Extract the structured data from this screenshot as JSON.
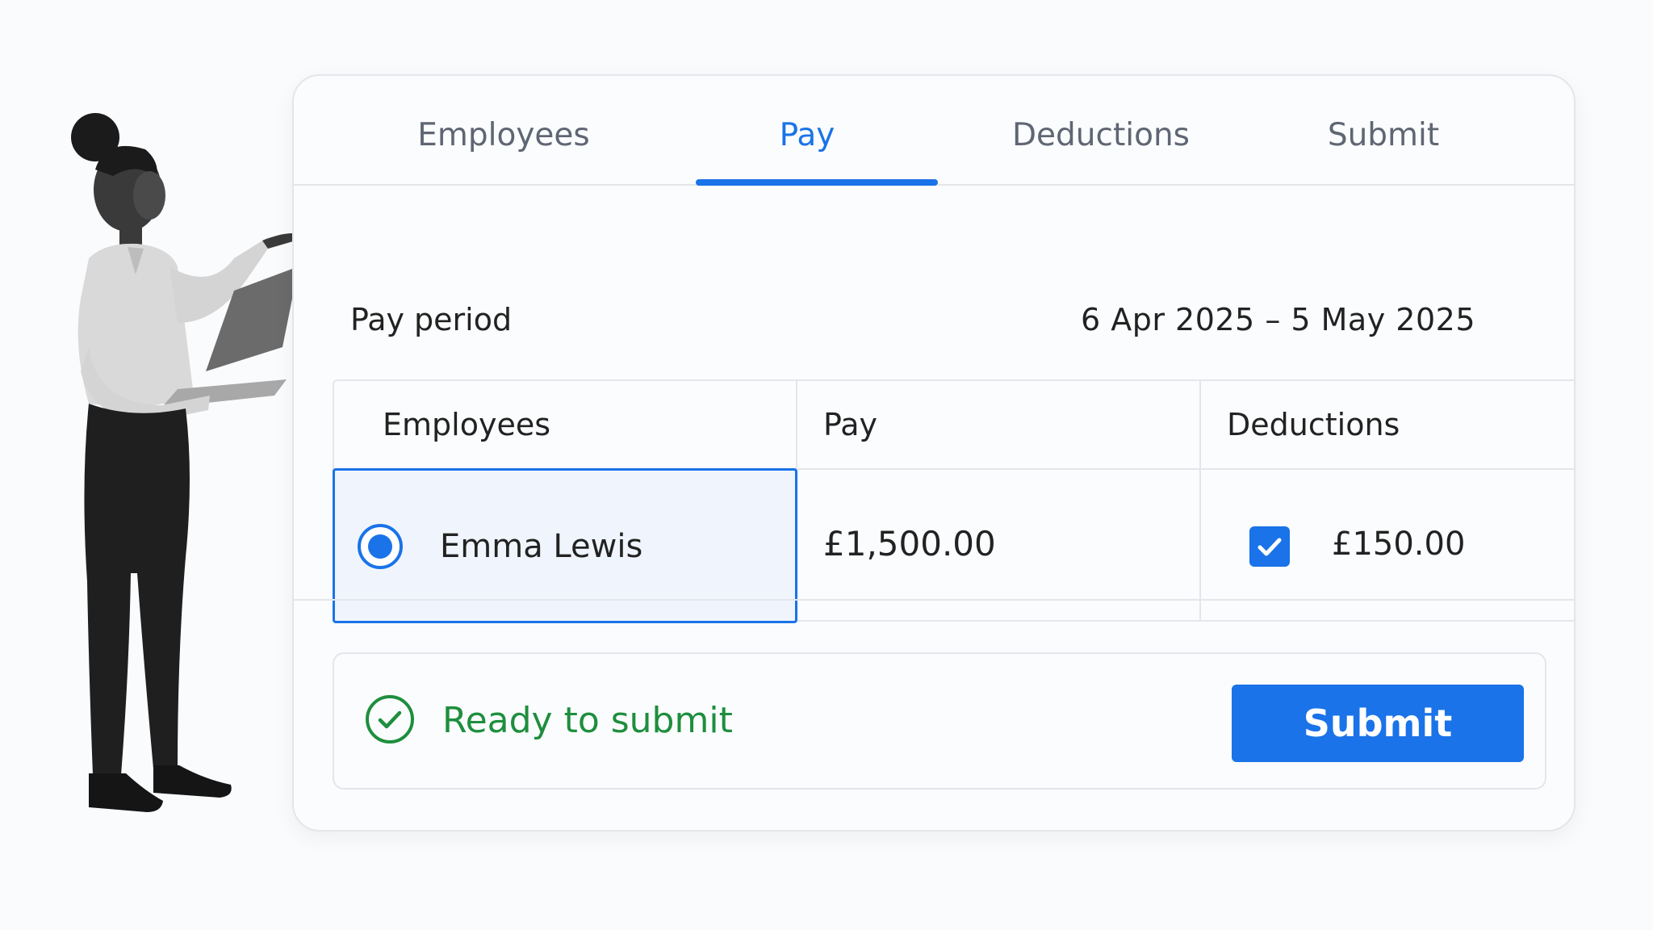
{
  "tabs": [
    {
      "label": "Employees",
      "active": false
    },
    {
      "label": "Pay",
      "active": true
    },
    {
      "label": "Deductions",
      "active": false
    },
    {
      "label": "Submit",
      "active": false
    }
  ],
  "pay_period": {
    "label": "Pay period",
    "value": "6 Apr 2025 – 5 May 2025"
  },
  "table": {
    "headers": [
      "Employees",
      "Pay",
      "Deductions"
    ],
    "rows": [
      {
        "employee": "Emma Lewis",
        "selected": true,
        "pay": "£1,500.00",
        "deduction_checked": true,
        "deduction": "£150.00"
      }
    ]
  },
  "status": {
    "text": "Ready to submit",
    "icon": "check-circle-icon",
    "color": "#1e8e3e"
  },
  "submit_button": {
    "label": "Submit"
  },
  "colors": {
    "accent": "#1a73e8",
    "success": "#1e8e3e",
    "border": "#e3e6ea"
  }
}
